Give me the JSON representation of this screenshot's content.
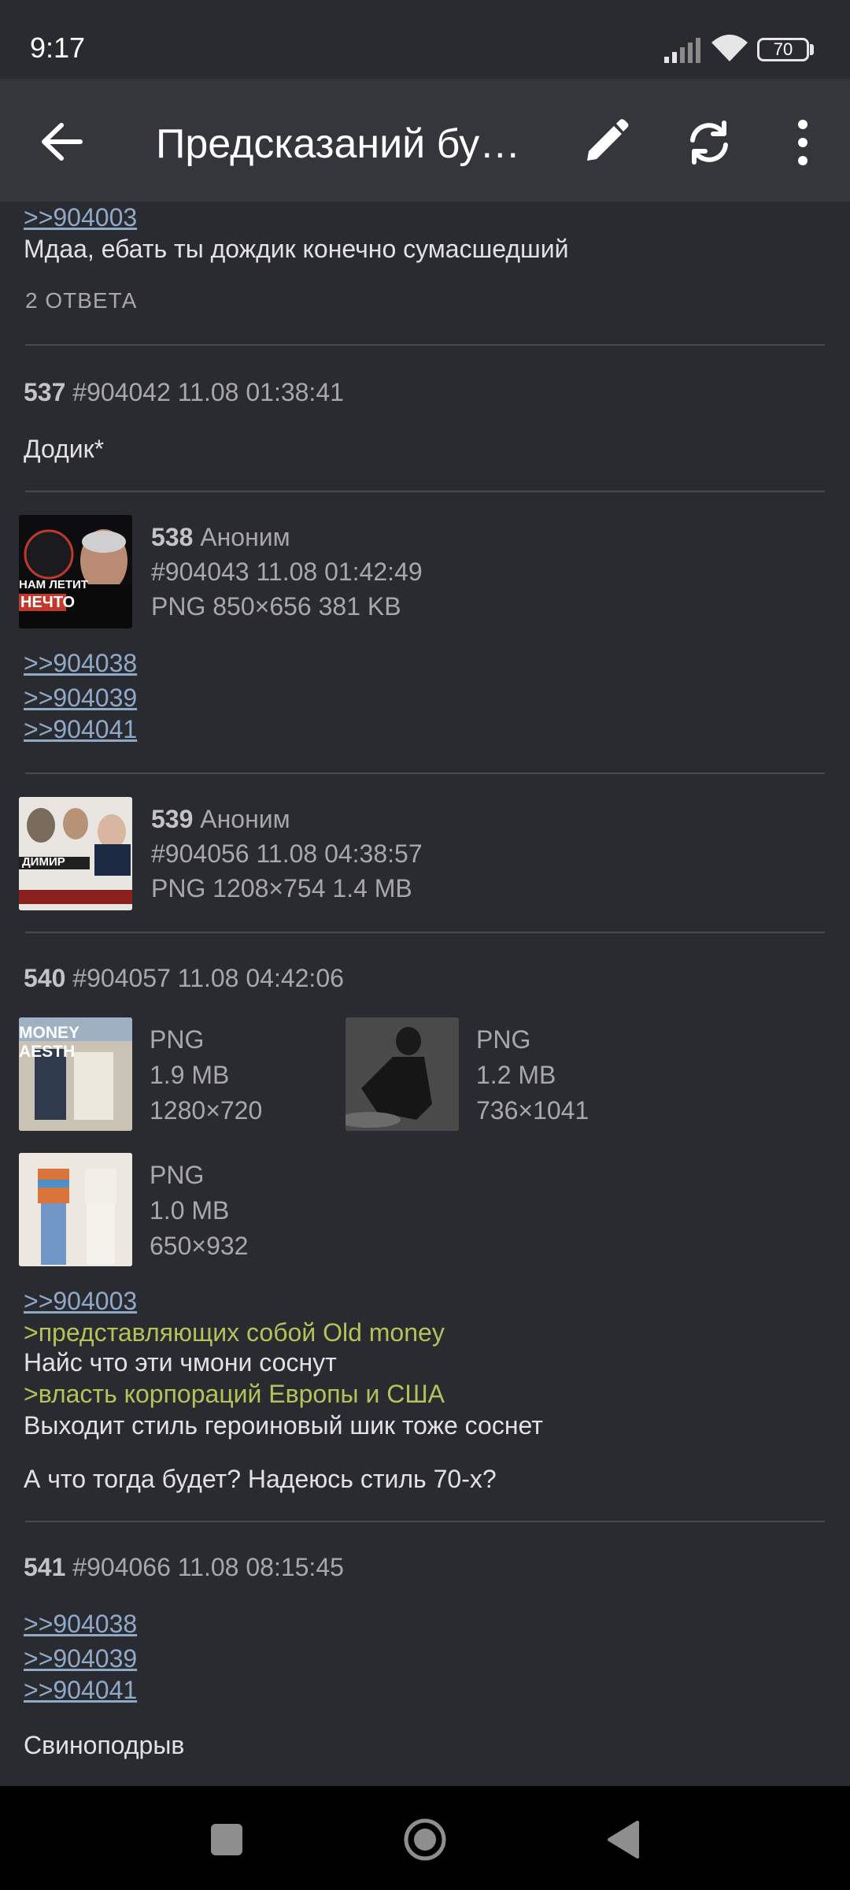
{
  "status": {
    "time": "9:17",
    "battery": "70"
  },
  "appbar": {
    "title": "Предсказаний бу…"
  },
  "posts": {
    "p536": {
      "reply_link": ">>904003",
      "text": "Мдаа, ебать ты дождик конечно сумасшедший",
      "replies": "2 ОТВЕТА"
    },
    "p537": {
      "num": "537",
      "info": "#904042 11.08 01:38:41",
      "text": "Додик*"
    },
    "p538": {
      "num": "538",
      "author": "Аноним",
      "info": "#904043 11.08 01:42:49",
      "file": "PNG 850×656 381 KB",
      "links": [
        ">>904038",
        ">>904039",
        ">>904041"
      ],
      "thumb_text": [
        "НАМ ЛЕТИТ",
        "НЕЧТО"
      ]
    },
    "p539": {
      "num": "539",
      "author": "Аноним",
      "info": "#904056 11.08 04:38:57",
      "file": "PNG 1208×754 1.4 MB",
      "thumb_text": [
        "ДИМИР"
      ]
    },
    "p540": {
      "num": "540",
      "info": "#904057 11.08 04:42:06",
      "images": [
        {
          "type": "PNG",
          "size": "1.9 MB",
          "dims": "1280×720",
          "thumb_text": "MONEY AESTH"
        },
        {
          "type": "PNG",
          "size": "1.2 MB",
          "dims": "736×1041"
        },
        {
          "type": "PNG",
          "size": "1.0 MB",
          "dims": "650×932"
        }
      ],
      "reply_link": ">>904003",
      "quote1": ">представляющих собой Old money",
      "line1": "Найс что эти чмони соснут",
      "quote2": ">власть корпораций Европы и США",
      "line2": "Выходит стиль героиновый шик тоже соснет",
      "line3": "А что тогда будет? Надеюсь стиль 70-х?"
    },
    "p541": {
      "num": "541",
      "info": "#904066 11.08 08:15:45",
      "links": [
        ">>904038",
        ">>904039",
        ">>904041"
      ],
      "text": "Свиноподрыв"
    }
  },
  "icons": {
    "back": "arrow-left-icon",
    "edit": "pencil-icon",
    "refresh": "refresh-icon",
    "more": "more-vert-icon"
  }
}
